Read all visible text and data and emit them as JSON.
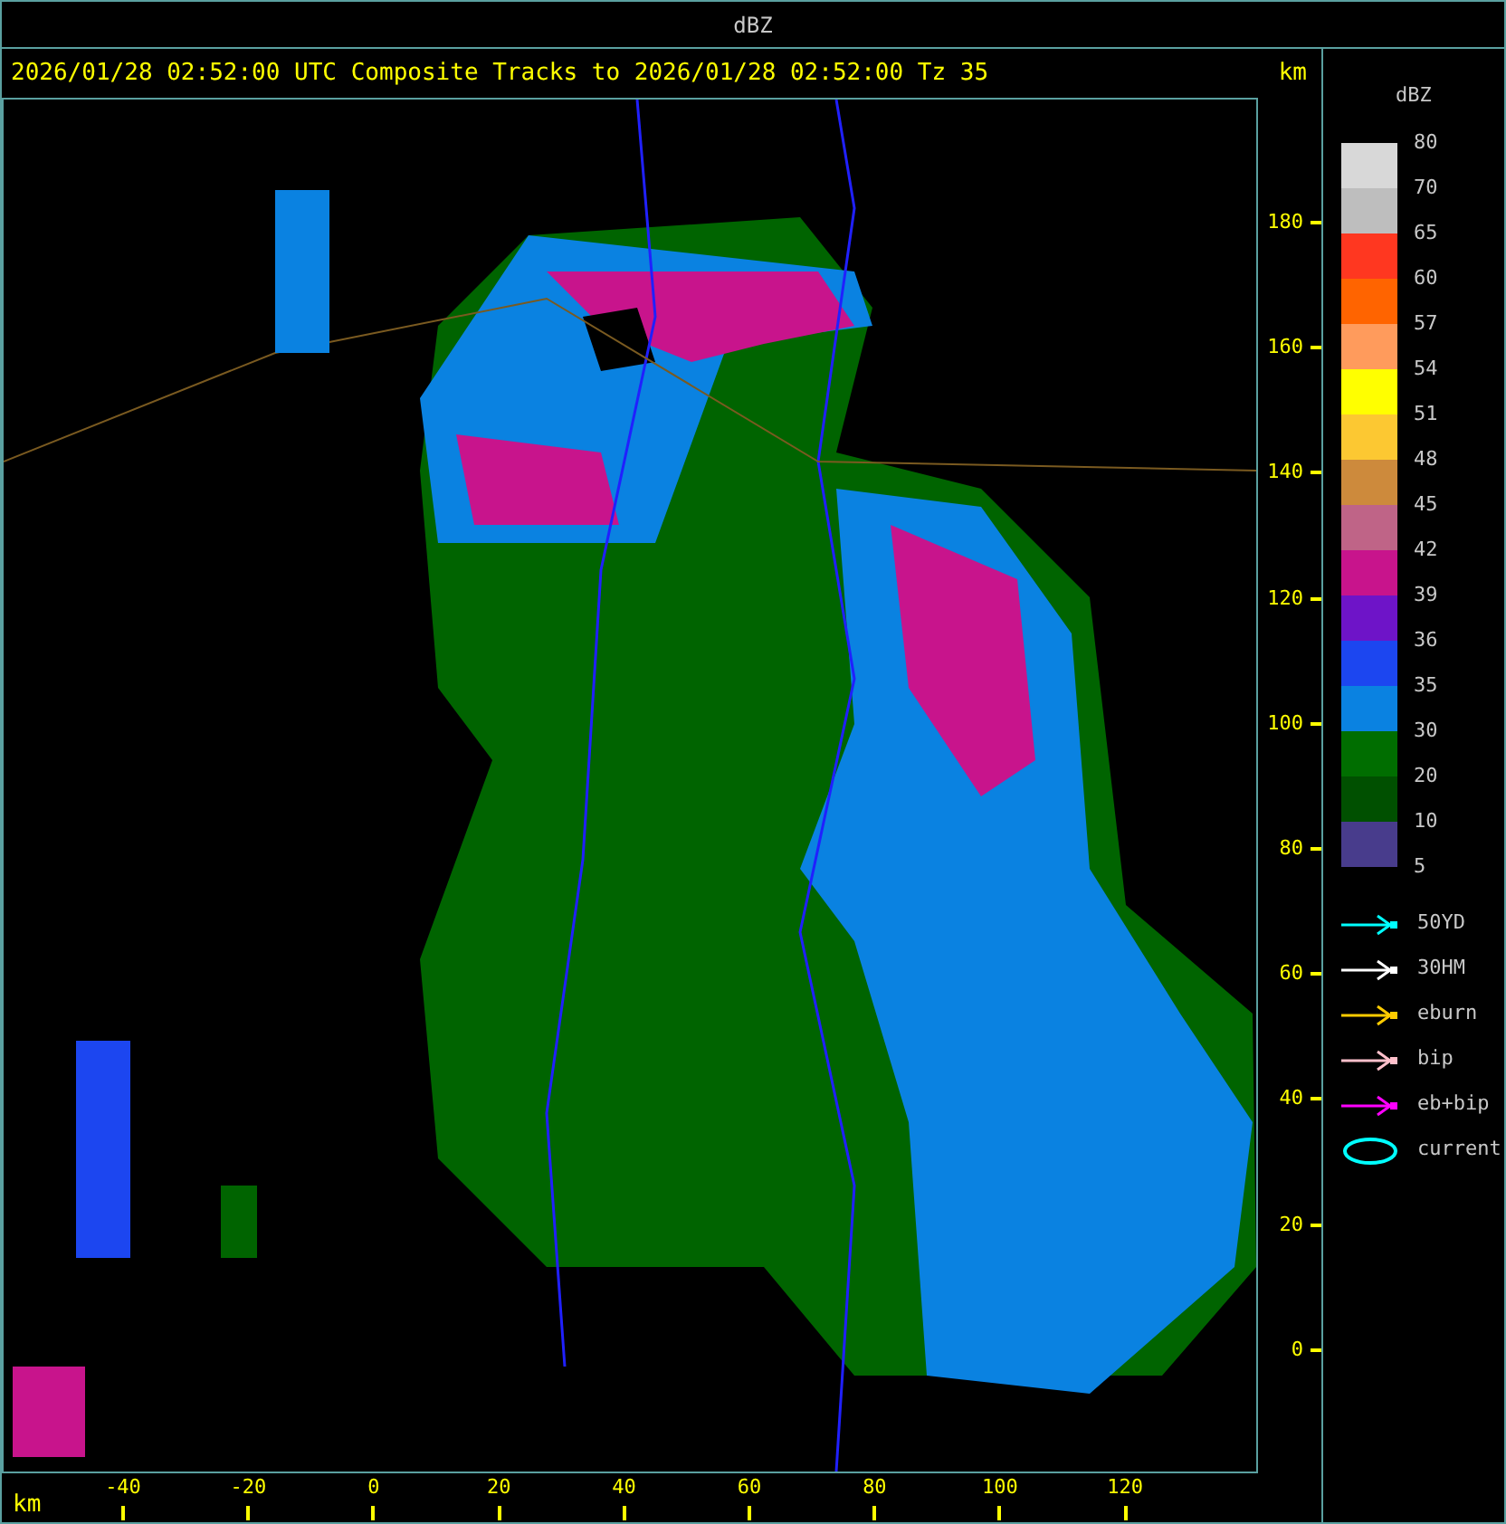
{
  "window": {
    "title": "dBZ"
  },
  "plot": {
    "title": "2026/01/28 02:52:00 UTC Composite Tracks to 2026/01/28 02:52:00 Tz 35",
    "y_axis": {
      "unit": "km",
      "ticks": [
        "180",
        "160",
        "140",
        "120",
        "100",
        "80",
        "60",
        "40",
        "20",
        "0"
      ]
    },
    "x_axis": {
      "unit": "km",
      "ticks": [
        "-40",
        "-20",
        "0",
        "20",
        "40",
        "60",
        "80",
        "100",
        "120"
      ]
    }
  },
  "legend": {
    "title": "dBZ",
    "labels": [
      "80",
      "70",
      "65",
      "60",
      "57",
      "54",
      "51",
      "48",
      "45",
      "42",
      "39",
      "36",
      "35",
      "30",
      "20",
      "10",
      "5"
    ],
    "bands": [
      {
        "color": "#d8d8d8"
      },
      {
        "color": "#bebebe"
      },
      {
        "color": "#ff3720"
      },
      {
        "color": "#ff6400"
      },
      {
        "color": "#ff9b5c"
      },
      {
        "color": "#ffff00"
      },
      {
        "color": "#fcc832"
      },
      {
        "color": "#cd8a3c"
      },
      {
        "color": "#bf6487"
      },
      {
        "color": "#c8148c"
      },
      {
        "color": "#6e14c8"
      },
      {
        "color": "#1c46f0"
      },
      {
        "color": "#0a82e1"
      },
      {
        "color": "#006e00"
      },
      {
        "color": "#005000"
      },
      {
        "color": "#483c8c"
      }
    ],
    "tracks": [
      {
        "kind": "arrow",
        "label": "50YD",
        "color": "#00ffff"
      },
      {
        "kind": "arrow",
        "label": "30HM",
        "color": "#ffffff"
      },
      {
        "kind": "arrow",
        "label": "eburn",
        "color": "#ffcc00"
      },
      {
        "kind": "arrow",
        "label": "bip",
        "color": "#ffc0cb"
      },
      {
        "kind": "arrow",
        "label": "eb+bip",
        "color": "#ff00ff"
      },
      {
        "kind": "ellipse",
        "label": "current",
        "color": "#00ffff"
      }
    ]
  }
}
